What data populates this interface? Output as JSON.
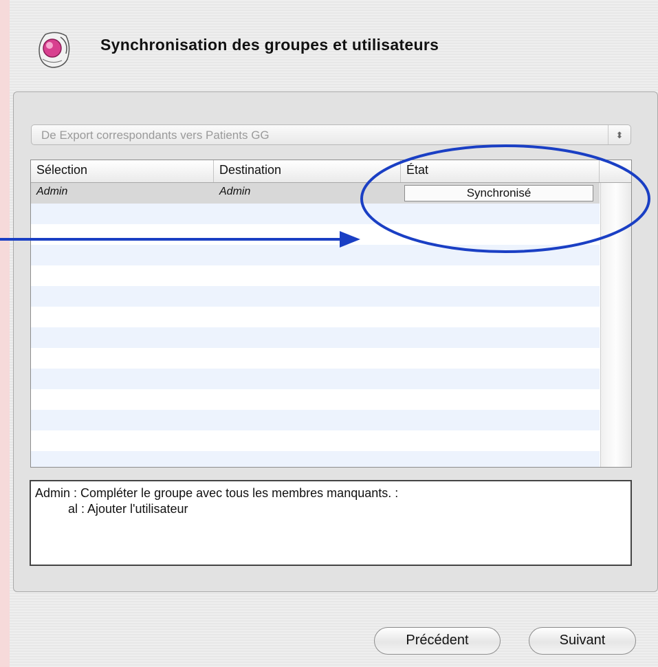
{
  "header": {
    "title": "Synchronisation des groupes et utilisateurs",
    "icon": "sync-user-icon"
  },
  "popup": {
    "selected": "De Export correspondants  vers Patients GG",
    "arrows": "⬍"
  },
  "table": {
    "columns": [
      "Sélection",
      "Destination",
      "État"
    ],
    "rows": [
      {
        "selection": "Admin",
        "destination": "Admin",
        "status": "Synchronisé"
      }
    ]
  },
  "message": {
    "line1": "Admin : Compléter le groupe avec tous les membres manquants. :",
    "line2": "al : Ajouter l'utilisateur"
  },
  "buttons": {
    "previous": "Précédent",
    "next": "Suivant"
  },
  "colors": {
    "annotation": "#1a3fc4",
    "background": "#f6dada",
    "stripe": "#edf3fd"
  }
}
